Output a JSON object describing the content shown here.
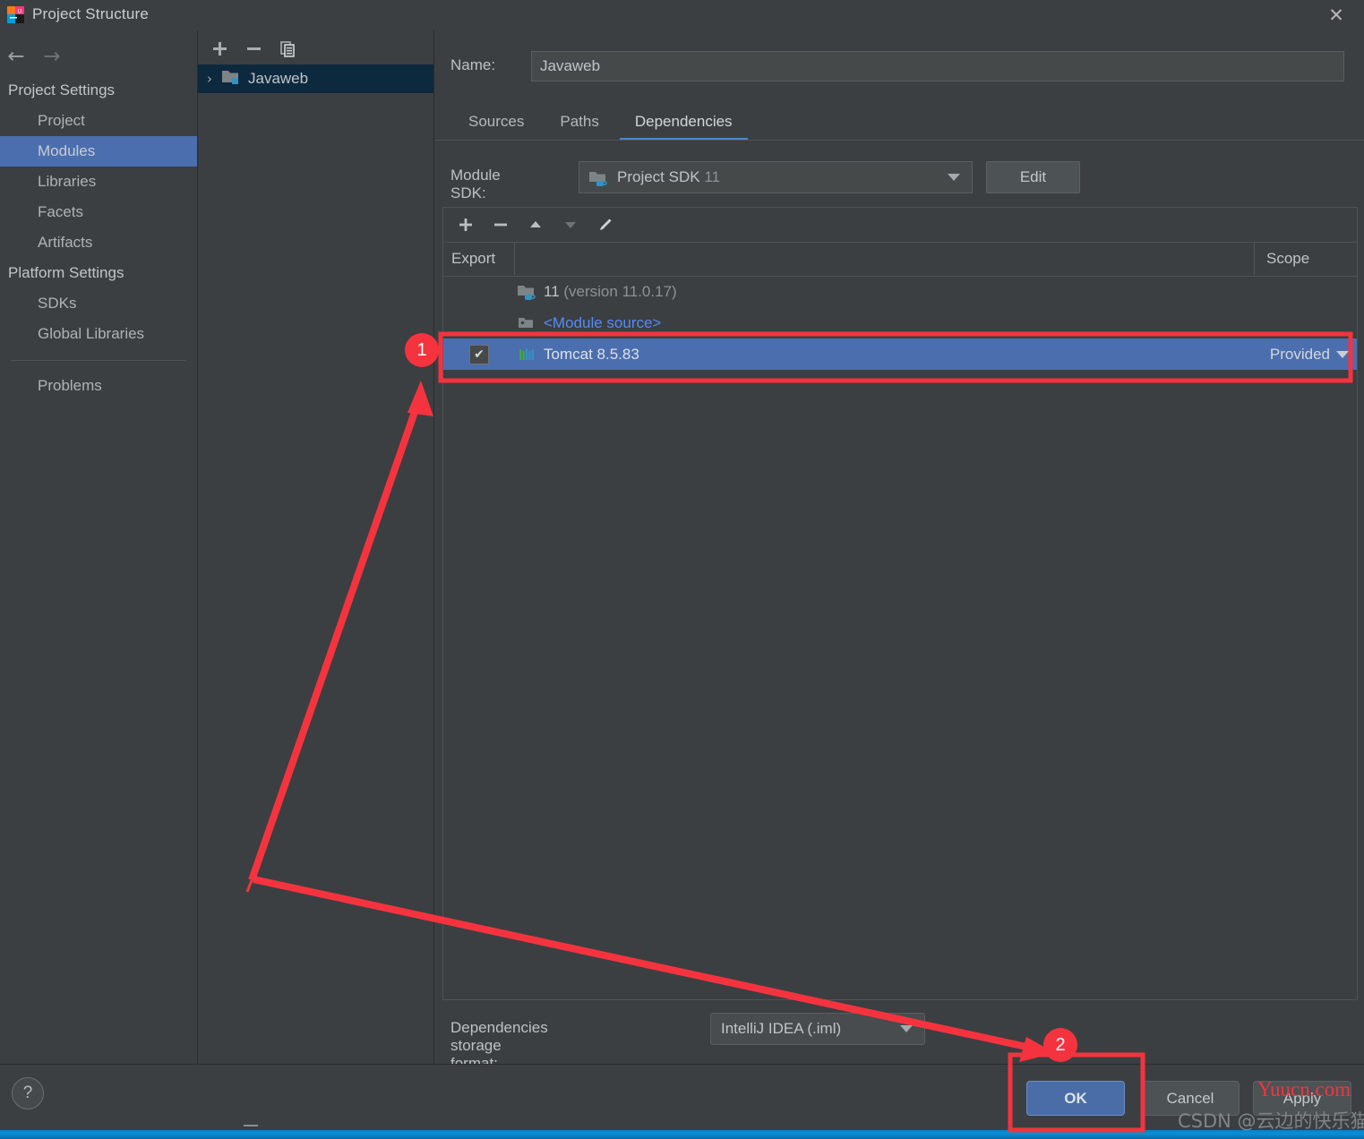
{
  "window": {
    "title": "Project Structure",
    "app_icon": "intellij-idea-icon",
    "close_label": "✕"
  },
  "nav": {
    "back_icon": "←",
    "forward_icon": "→",
    "groups": [
      {
        "label": "Project Settings",
        "items": [
          {
            "label": "Project",
            "selected": false
          },
          {
            "label": "Modules",
            "selected": true
          },
          {
            "label": "Libraries",
            "selected": false
          },
          {
            "label": "Facets",
            "selected": false
          },
          {
            "label": "Artifacts",
            "selected": false
          }
        ]
      },
      {
        "label": "Platform Settings",
        "items": [
          {
            "label": "SDKs",
            "selected": false
          },
          {
            "label": "Global Libraries",
            "selected": false
          }
        ]
      }
    ],
    "problems_label": "Problems",
    "help_label": "?"
  },
  "module_tree": {
    "toolbar": [
      {
        "name": "add-module-button",
        "glyph": "＋"
      },
      {
        "name": "remove-module-button",
        "glyph": "−"
      },
      {
        "name": "copy-module-button",
        "glyph": "⧉"
      }
    ],
    "root": {
      "label": "Javaweb",
      "chevron": "›",
      "selected": true
    }
  },
  "module": {
    "name_label": "Name:",
    "name_value": "Javaweb",
    "name_placeholder": "Module name",
    "tabs": [
      {
        "label": "Sources",
        "active": false
      },
      {
        "label": "Paths",
        "active": false
      },
      {
        "label": "Dependencies",
        "active": true
      }
    ],
    "sdk": {
      "label": "Module SDK:",
      "value": "Project SDK",
      "value_dim": "11",
      "edit_label": "Edit"
    }
  },
  "dependencies": {
    "toolbar": [
      {
        "name": "add-dependency-button",
        "glyph": "＋",
        "enabled": true
      },
      {
        "name": "remove-dependency-button",
        "glyph": "−",
        "enabled": true
      },
      {
        "name": "move-up-button",
        "glyph": "▲",
        "enabled": true
      },
      {
        "name": "move-down-button",
        "glyph": "▼",
        "enabled": false
      },
      {
        "name": "edit-dependency-button",
        "glyph": "╱",
        "enabled": true
      }
    ],
    "columns": {
      "export": "Export",
      "scope": "Scope"
    },
    "rows": [
      {
        "icon": "jdk-folder-icon",
        "label": "11",
        "label_dim": " (version 11.0.17)",
        "checked": null,
        "scope": "",
        "selected": false,
        "link": false
      },
      {
        "icon": "module-source-icon",
        "label": "<Module source>",
        "label_dim": "",
        "checked": null,
        "scope": "",
        "selected": false,
        "link": true
      },
      {
        "icon": "library-bars-icon",
        "label": "Tomcat 8.5.83",
        "label_dim": "",
        "checked": true,
        "checkmark": "✔",
        "scope": "Provided",
        "selected": true,
        "link": false
      }
    ]
  },
  "storage": {
    "label": "Dependencies storage format:",
    "value": "IntelliJ IDEA (.iml)"
  },
  "footer": {
    "ok_label": "OK",
    "cancel_label": "Cancel",
    "apply_label": "Apply"
  },
  "annotations": {
    "badge_1": "1",
    "badge_2": "2",
    "highlight_color": "#f5333f"
  },
  "watermarks": {
    "site": "Yuucn.com",
    "author": "CSDN @云边的快乐猫"
  }
}
